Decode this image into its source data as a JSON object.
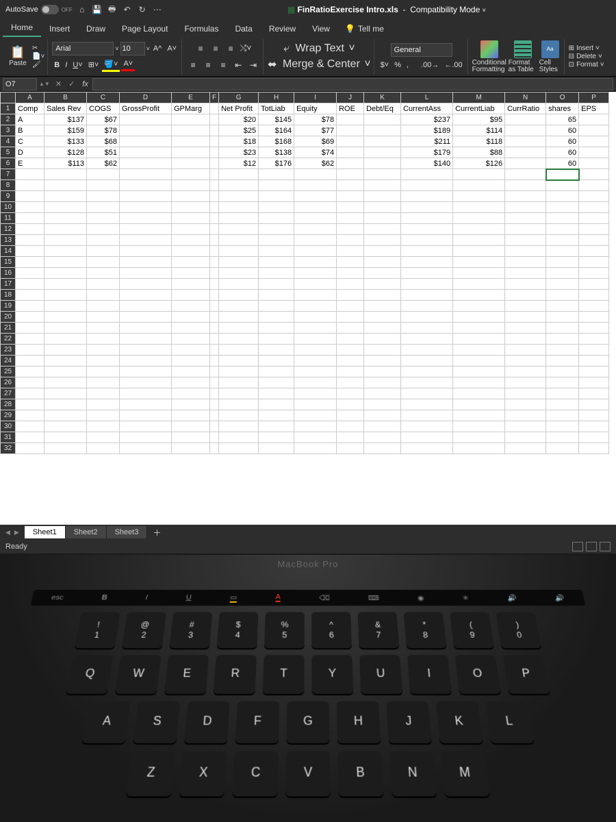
{
  "titlebar": {
    "autosave_label": "AutoSave",
    "autosave_state": "OFF",
    "filename": "FinRatioExercise Intro.xls",
    "mode": "Compatibility Mode"
  },
  "tabs": [
    "Home",
    "Insert",
    "Draw",
    "Page Layout",
    "Formulas",
    "Data",
    "Review",
    "View"
  ],
  "tellme": "Tell me",
  "ribbon": {
    "paste": "Paste",
    "font_name": "Arial",
    "font_size": "10",
    "wrap": "Wrap Text",
    "merge": "Merge & Center",
    "num_format": "General",
    "cond_fmt": "Conditional Formatting",
    "fmt_table": "Format as Table",
    "cell_styles": "Cell Styles",
    "insert": "Insert",
    "delete": "Delete",
    "format": "Format"
  },
  "namebox": "O7",
  "columns": [
    "A",
    "B",
    "C",
    "D",
    "E",
    "F",
    "G",
    "H",
    "I",
    "J",
    "K",
    "L",
    "M",
    "N",
    "O",
    "P"
  ],
  "headers": {
    "A": "Comp",
    "B": "Sales Rev",
    "C": "COGS",
    "D": "GrossProfit",
    "E": "GPMarg",
    "F": "",
    "G": "Net Profit",
    "H": "TotLiab",
    "I": "Equity",
    "J": "ROE",
    "K": "Debt/Eq",
    "L": "CurrentAss",
    "M": "CurrentLiab",
    "N": "CurrRatio",
    "O": "shares",
    "P": "EPS"
  },
  "rows": [
    {
      "A": "A",
      "B": "$137",
      "C": "$67",
      "G": "$20",
      "H": "$145",
      "I": "$78",
      "L": "$237",
      "M": "$95",
      "O": "65"
    },
    {
      "A": "B",
      "B": "$159",
      "C": "$78",
      "G": "$25",
      "H": "$164",
      "I": "$77",
      "L": "$189",
      "M": "$114",
      "O": "60"
    },
    {
      "A": "C",
      "B": "$133",
      "C": "$68",
      "G": "$18",
      "H": "$168",
      "I": "$69",
      "L": "$211",
      "M": "$118",
      "O": "60"
    },
    {
      "A": "D",
      "B": "$128",
      "C": "$51",
      "G": "$23",
      "H": "$138",
      "I": "$74",
      "L": "$179",
      "M": "$88",
      "O": "60"
    },
    {
      "A": "E",
      "B": "$113",
      "C": "$62",
      "G": "$12",
      "H": "$176",
      "I": "$62",
      "L": "$140",
      "M": "$126",
      "O": "60"
    }
  ],
  "visible_row_count": 32,
  "sheets": [
    "Sheet1",
    "Sheet2",
    "Sheet3"
  ],
  "active_sheet": 0,
  "status": "Ready",
  "macbook": "MacBook Pro",
  "touchbar": [
    "esc",
    "B",
    "I",
    "U",
    "A",
    "〈",
    "✳",
    "🔊"
  ],
  "keys_r1": [
    [
      "!",
      "1"
    ],
    [
      "@",
      "2"
    ],
    [
      "#",
      "3"
    ],
    [
      "$",
      "4"
    ],
    [
      "%",
      "5"
    ],
    [
      "^",
      "6"
    ],
    [
      "&",
      "7"
    ],
    [
      "*",
      "8"
    ],
    [
      "(",
      "9"
    ],
    [
      ")",
      "0"
    ]
  ],
  "keys_r2": [
    "Q",
    "W",
    "E",
    "R",
    "T",
    "Y",
    "U",
    "I",
    "O",
    "P"
  ],
  "keys_r3": [
    "A",
    "S",
    "D",
    "F",
    "G",
    "H",
    "J",
    "K",
    "L"
  ],
  "keys_r4": [
    "Z",
    "X",
    "C",
    "V",
    "B",
    "N",
    "M"
  ]
}
